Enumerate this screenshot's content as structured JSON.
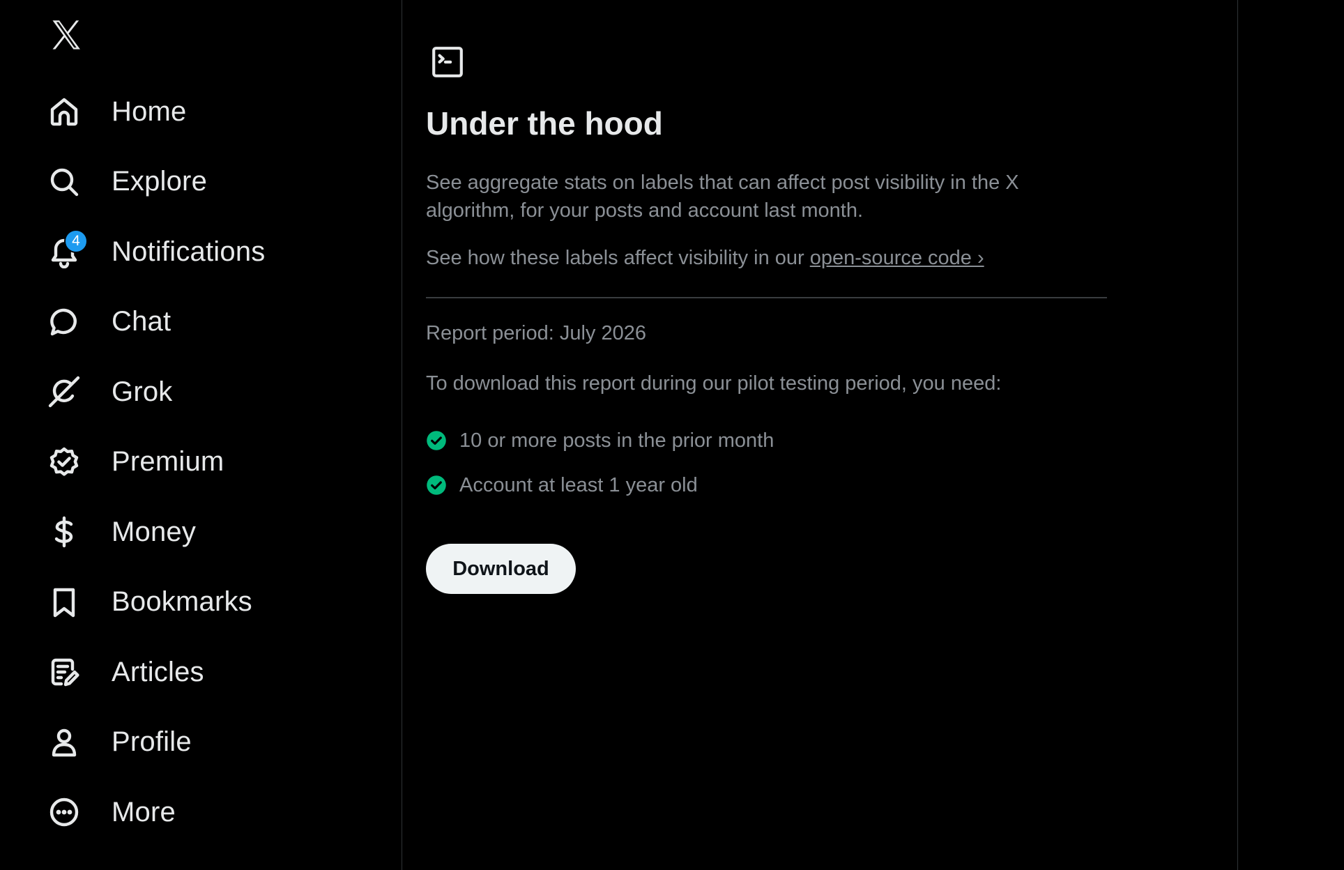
{
  "sidebar": {
    "logo_icon": "x-logo-icon",
    "items": [
      {
        "label": "Home",
        "icon": "home-icon"
      },
      {
        "label": "Explore",
        "icon": "search-icon"
      },
      {
        "label": "Notifications",
        "icon": "bell-icon",
        "badge": "4"
      },
      {
        "label": "Chat",
        "icon": "chat-bubble-icon"
      },
      {
        "label": "Grok",
        "icon": "grok-icon"
      },
      {
        "label": "Premium",
        "icon": "verified-badge-icon"
      },
      {
        "label": "Money",
        "icon": "dollar-icon"
      },
      {
        "label": "Bookmarks",
        "icon": "bookmark-icon"
      },
      {
        "label": "Articles",
        "icon": "article-edit-icon"
      },
      {
        "label": "Profile",
        "icon": "person-icon"
      },
      {
        "label": "More",
        "icon": "more-circle-icon"
      }
    ]
  },
  "main": {
    "header_icon": "terminal-icon",
    "title": "Under the hood",
    "description": "See aggregate stats on labels that can affect post visibility in the X algorithm, for your posts and account last month.",
    "link_prefix": "See how these labels affect visibility in our ",
    "link_text": "open-source code ›",
    "report_period": "Report period: July 2026",
    "requirements_intro": "To download this report during our pilot testing period, you need:",
    "requirements": [
      {
        "text": "10 or more posts in the prior month",
        "met": true
      },
      {
        "text": "Account at least 1 year old",
        "met": true
      }
    ],
    "download_label": "Download"
  },
  "colors": {
    "background": "#000000",
    "text_primary": "#e7e9ea",
    "text_secondary": "#8b9096",
    "badge": "#1d9bf0",
    "check": "#00ba7c",
    "button_bg": "#eff3f4"
  }
}
